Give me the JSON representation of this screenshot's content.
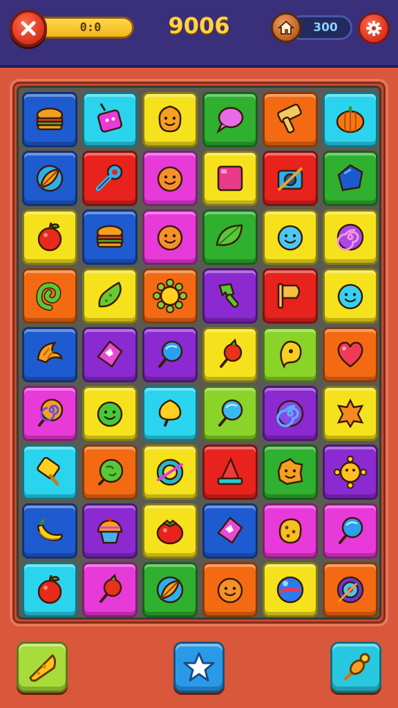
{
  "header": {
    "moves": "0:0",
    "score": "9006",
    "coins": "300"
  },
  "icons": {
    "close": "close-x-icon",
    "coin": "house-coin-icon",
    "settings": "gear-icon"
  },
  "board": {
    "rows": 9,
    "cols": 6,
    "tiles": [
      [
        {
          "bg": "#1f5bd0",
          "icon": "burger"
        },
        {
          "bg": "#2ad4ee",
          "icon": "juice-box"
        },
        {
          "bg": "#f6e21c",
          "icon": "smiley-blob"
        },
        {
          "bg": "#2fb02f",
          "icon": "speech-candy"
        },
        {
          "bg": "#f46a12",
          "icon": "hammer"
        },
        {
          "bg": "#2ad4ee",
          "icon": "pumpkin"
        }
      ],
      [
        {
          "bg": "#1f5bd0",
          "icon": "leaf-ring"
        },
        {
          "bg": "#e8221c",
          "icon": "key"
        },
        {
          "bg": "#e83ad8",
          "icon": "smiley-orange"
        },
        {
          "bg": "#f6e21c",
          "icon": "pink-square"
        },
        {
          "bg": "#e8221c",
          "icon": "camera"
        },
        {
          "bg": "#2fb02f",
          "icon": "blue-gem"
        }
      ],
      [
        {
          "bg": "#f6e21c",
          "icon": "apple"
        },
        {
          "bg": "#1f5bd0",
          "icon": "burger"
        },
        {
          "bg": "#e83ad8",
          "icon": "smiley-orange"
        },
        {
          "bg": "#2fb02f",
          "icon": "green-leaf"
        },
        {
          "bg": "#f6e21c",
          "icon": "smiley-blue"
        },
        {
          "bg": "#f6e21c",
          "icon": "swirl"
        }
      ],
      [
        {
          "bg": "#f46a12",
          "icon": "green-swirl"
        },
        {
          "bg": "#f6e21c",
          "icon": "pickle"
        },
        {
          "bg": "#f46a12",
          "icon": "sun"
        },
        {
          "bg": "#8a2ad0",
          "icon": "green-brush"
        },
        {
          "bg": "#e8221c",
          "icon": "flag"
        },
        {
          "bg": "#f6e21c",
          "icon": "smiley-cyan"
        }
      ],
      [
        {
          "bg": "#1f5bd0",
          "icon": "croissant"
        },
        {
          "bg": "#8a2ad0",
          "icon": "pink-gem"
        },
        {
          "bg": "#8a2ad0",
          "icon": "blue-lollipop"
        },
        {
          "bg": "#f6e21c",
          "icon": "red-candy"
        },
        {
          "bg": "#8ad42a",
          "icon": "yellow-drop"
        },
        {
          "bg": "#f46a12",
          "icon": "heart"
        }
      ],
      [
        {
          "bg": "#e83ad8",
          "icon": "swirl-lollipop"
        },
        {
          "bg": "#f6e21c",
          "icon": "smiley-green"
        },
        {
          "bg": "#2ad4ee",
          "icon": "yellow-lollipop"
        },
        {
          "bg": "#8ad42a",
          "icon": "cyan-lollipop"
        },
        {
          "bg": "#8a2ad0",
          "icon": "blue-swirl"
        },
        {
          "bg": "#f6e21c",
          "icon": "orange-star"
        }
      ],
      [
        {
          "bg": "#2ad4ee",
          "icon": "ice-pop"
        },
        {
          "bg": "#f46a12",
          "icon": "green-world"
        },
        {
          "bg": "#f6e21c",
          "icon": "teal-ring"
        },
        {
          "bg": "#e8221c",
          "icon": "cone"
        },
        {
          "bg": "#2fb02f",
          "icon": "smiley-gold"
        },
        {
          "bg": "#8a2ad0",
          "icon": "sun-yellow"
        }
      ],
      [
        {
          "bg": "#1f5bd0",
          "icon": "banana"
        },
        {
          "bg": "#8a2ad0",
          "icon": "cupcake"
        },
        {
          "bg": "#f6e21c",
          "icon": "tomato"
        },
        {
          "bg": "#1f5bd0",
          "icon": "pink-gem"
        },
        {
          "bg": "#e83ad8",
          "icon": "cookie"
        },
        {
          "bg": "#e83ad8",
          "icon": "blue-lollipop"
        }
      ],
      [
        {
          "bg": "#2ad4ee",
          "icon": "apple"
        },
        {
          "bg": "#e83ad8",
          "icon": "red-candy"
        },
        {
          "bg": "#2fb02f",
          "icon": "leaf-ring"
        },
        {
          "bg": "#f46a12",
          "icon": "smiley-orange"
        },
        {
          "bg": "#f6e21c",
          "icon": "blue-orb"
        },
        {
          "bg": "#f46a12",
          "icon": "target"
        }
      ]
    ]
  },
  "boosters": [
    {
      "icon": "cheese-wedge-icon",
      "bg": "#a8dc3a"
    },
    {
      "icon": "star-icon",
      "bg": "#2a9ae8"
    },
    {
      "icon": "pin-candy-icon",
      "bg": "#28c8e0"
    }
  ]
}
